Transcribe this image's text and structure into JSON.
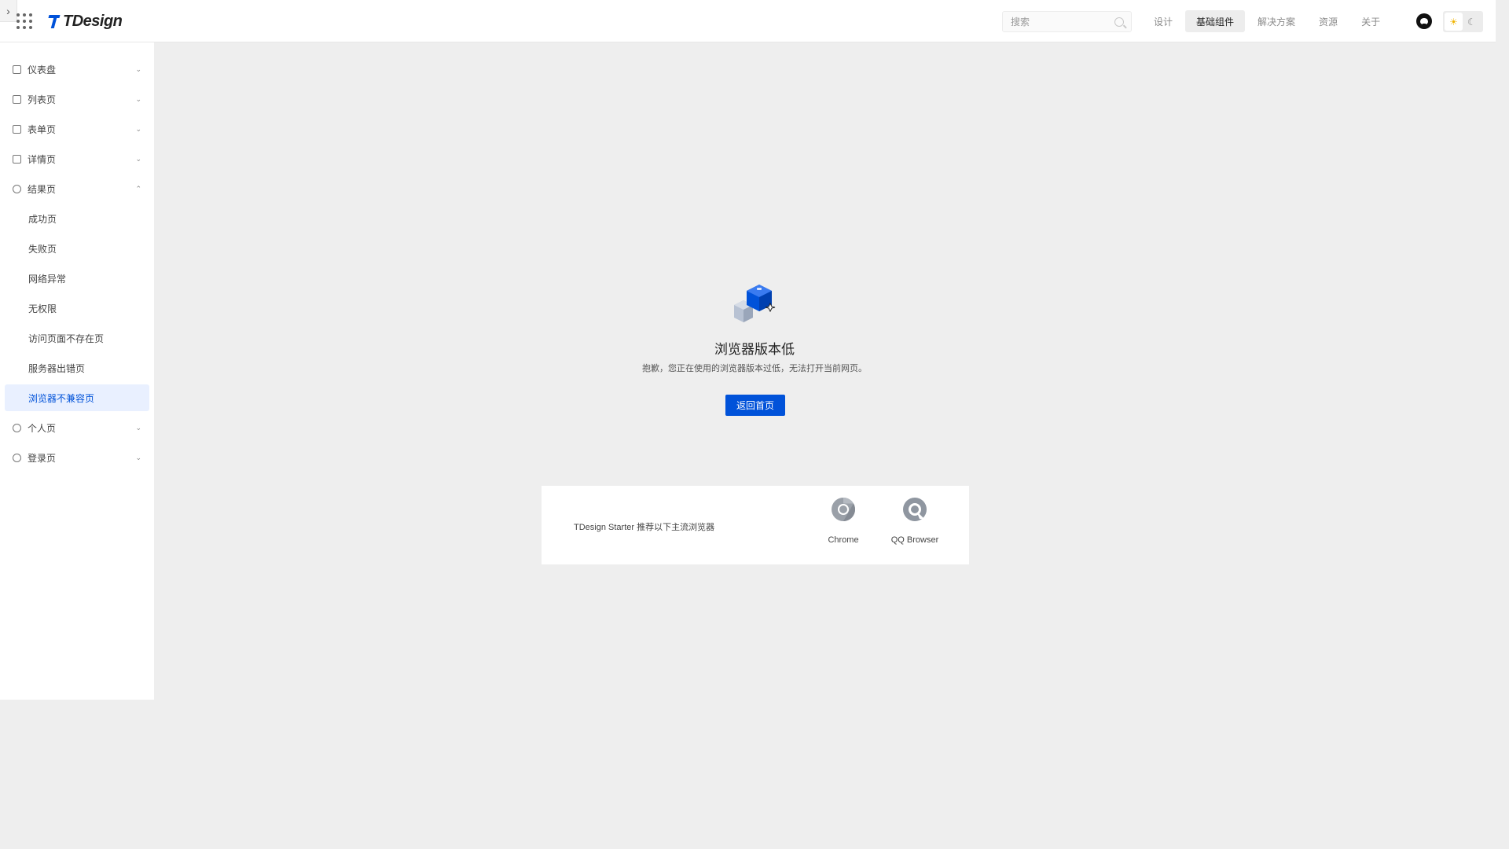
{
  "header": {
    "collapse_glyph": "›",
    "logo_text": "TDesign",
    "search_placeholder": "搜索",
    "nav": [
      {
        "label": "设计",
        "active": false
      },
      {
        "label": "基础组件",
        "active": true
      },
      {
        "label": "解决方案",
        "active": false
      },
      {
        "label": "资源",
        "active": false
      },
      {
        "label": "关于",
        "active": false
      }
    ],
    "theme_light_glyph": "☀",
    "theme_dark_glyph": "☾"
  },
  "sidebar": {
    "items": [
      {
        "label": "仪表盘",
        "icon": "dashboard-icon",
        "chevron": "⌄"
      },
      {
        "label": "列表页",
        "icon": "list-icon",
        "chevron": "⌄"
      },
      {
        "label": "表单页",
        "icon": "form-edit-icon",
        "chevron": "⌄"
      },
      {
        "label": "详情页",
        "icon": "detail-icon",
        "chevron": "⌄"
      },
      {
        "label": "结果页",
        "icon": "check-circle-icon",
        "chevron": "⌃"
      },
      {
        "label": "个人页",
        "icon": "user-circle-icon",
        "chevron": "⌄"
      },
      {
        "label": "登录页",
        "icon": "login-icon",
        "chevron": "⌄"
      }
    ],
    "result_sub": [
      {
        "label": "成功页"
      },
      {
        "label": "失败页"
      },
      {
        "label": "网络异常"
      },
      {
        "label": "无权限"
      },
      {
        "label": "访问页面不存在页"
      },
      {
        "label": "服务器出错页"
      },
      {
        "label": "浏览器不兼容页",
        "active": true
      }
    ]
  },
  "main": {
    "title": "浏览器版本低",
    "description": "抱歉，您正在使用的浏览器版本过低，无法打开当前网页。",
    "home_button": "返回首页",
    "recommend_text": "TDesign Starter 推荐以下主流浏览器",
    "browsers": [
      {
        "name": "Chrome",
        "icon": "chrome-icon"
      },
      {
        "name": "QQ Browser",
        "icon": "qq-browser-icon"
      }
    ]
  },
  "colors": {
    "brand": "#0052d9",
    "active_bg": "#e9f0ff",
    "page_bg": "#eeeeee"
  }
}
